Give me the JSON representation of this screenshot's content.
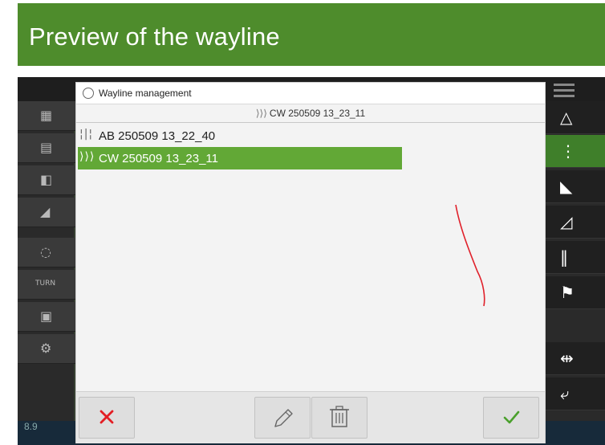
{
  "header": {
    "title": "Preview of the wayline"
  },
  "dialog": {
    "title": "Wayline management",
    "selected": "CW 250509 13_23_11",
    "items": [
      {
        "label": "AB 250509 13_22_40",
        "type": "AB",
        "selected": false
      },
      {
        "label": "CW 250509 13_23_11",
        "type": "CW",
        "selected": true
      }
    ]
  },
  "terminal": {
    "status_value": "8.9",
    "turn_label": "TURN"
  },
  "icons": {
    "dialog_header": "wayline-circle-icon",
    "cancel": "close-icon",
    "edit": "pencil-icon",
    "delete": "trash-icon",
    "confirm": "check-icon"
  },
  "colors": {
    "title_bar": "#4e8c2c",
    "selected_row": "#62a836",
    "cancel_red": "#e31e24",
    "confirm_green": "#4aa02c",
    "preview_line": "#e0202a"
  }
}
